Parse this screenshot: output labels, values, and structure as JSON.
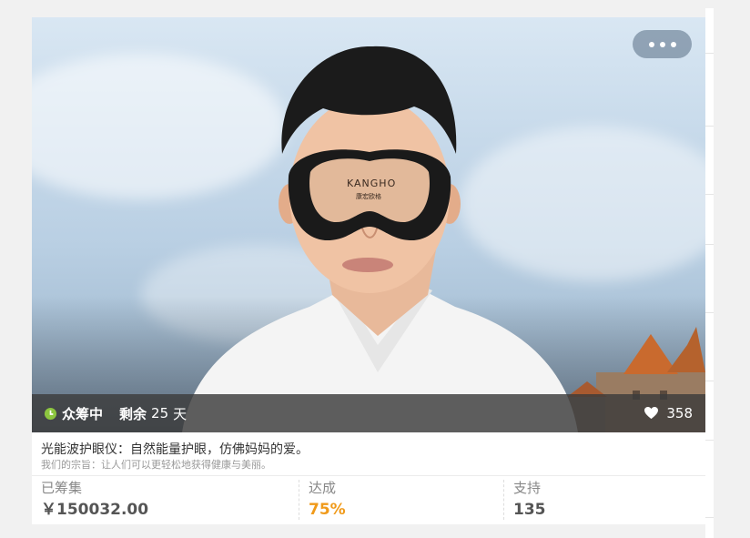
{
  "card": {
    "more_button_dots": "•••",
    "product_image": {
      "brand_text": "KANGHO",
      "brand_sub_text": "康宏欧格"
    },
    "status": {
      "state_label": "众筹中",
      "remaining_label": "剩余",
      "remaining_days": "25",
      "remaining_unit": "天",
      "like_count": "358"
    },
    "title": "光能波护眼仪：自然能量护眼，仿佛妈妈的爱。",
    "subtitle": "我们的宗旨：让人们可以更轻松地获得健康与美丽。",
    "stats": [
      {
        "label": "已筹集",
        "value": "￥150032.00"
      },
      {
        "label": "达成",
        "value": "75%"
      },
      {
        "label": "支持",
        "value": "135"
      }
    ]
  },
  "colors": {
    "accent_orange": "#f09a1a",
    "status_green": "#8cc63f"
  },
  "icons": {
    "status": "clock-icon",
    "like": "heart-icon",
    "more": "more-dots-icon"
  }
}
